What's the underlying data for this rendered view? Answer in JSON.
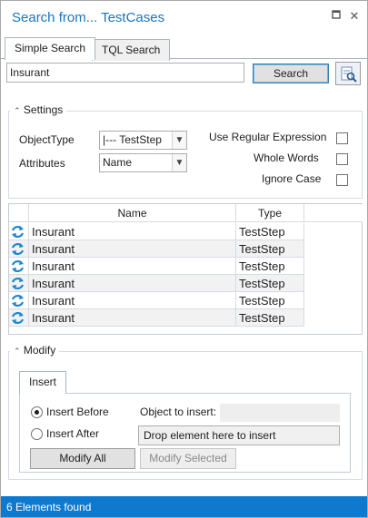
{
  "window": {
    "title": "Search from... TestCases"
  },
  "tabs": [
    {
      "label": "Simple Search",
      "active": true
    },
    {
      "label": "TQL Search",
      "active": false
    }
  ],
  "search": {
    "query": "Insurant",
    "button_label": "Search"
  },
  "settings": {
    "label": "Settings",
    "object_type_label": "ObjectType",
    "object_type_value": "|--- TestStep",
    "attributes_label": "Attributes",
    "attributes_value": "Name",
    "use_regex_label": "Use Regular Expression",
    "whole_words_label": "Whole Words",
    "ignore_case_label": "Ignore Case"
  },
  "results": {
    "columns": [
      "Name",
      "Type"
    ],
    "rows": [
      {
        "name": "Insurant",
        "type": "TestStep"
      },
      {
        "name": "Insurant",
        "type": "TestStep"
      },
      {
        "name": "Insurant",
        "type": "TestStep"
      },
      {
        "name": "Insurant",
        "type": "TestStep"
      },
      {
        "name": "Insurant",
        "type": "TestStep"
      },
      {
        "name": "Insurant",
        "type": "TestStep"
      }
    ]
  },
  "modify": {
    "label": "Modify",
    "tab_label": "Insert",
    "insert_before_label": "Insert Before",
    "insert_after_label": "Insert After",
    "object_to_insert_label": "Object to insert:",
    "object_to_insert_value": "",
    "drop_placeholder": "Drop element here to insert",
    "modify_all_label": "Modify All",
    "modify_selected_label": "Modify Selected"
  },
  "status": {
    "text": "6 Elements found"
  }
}
